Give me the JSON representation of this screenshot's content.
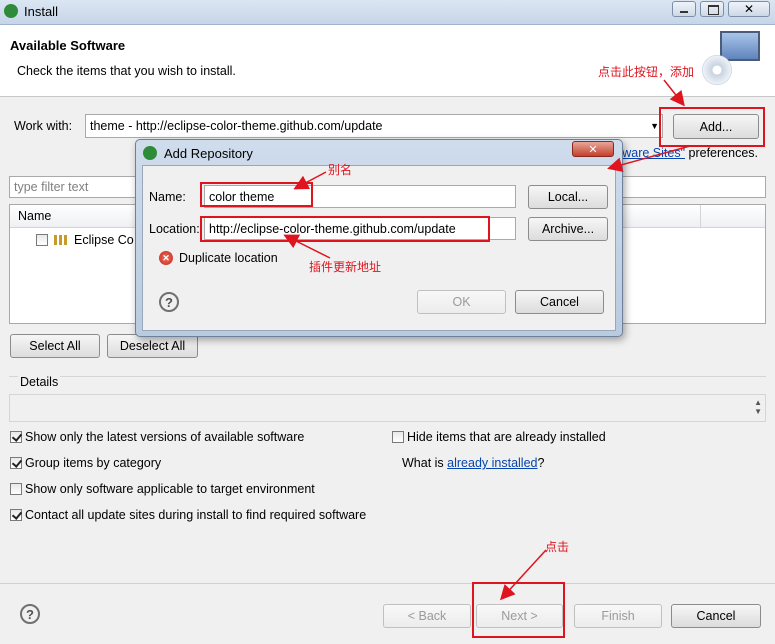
{
  "window": {
    "title": "Install",
    "section_title": "Available Software",
    "section_subtitle": "Check the items that you wish to install."
  },
  "work_with": {
    "label": "Work with:",
    "value": "theme - http://eclipse-color-theme.github.com/update",
    "add_label": "Add...",
    "hint_link": "Software Sites\"",
    "hint_suffix": "preferences."
  },
  "filter": {
    "placeholder": "type filter text"
  },
  "tree": {
    "column_name": "Name",
    "items": [
      {
        "label": "Eclipse Co"
      }
    ]
  },
  "buttons": {
    "select_all": "Select All",
    "deselect_all": "Deselect All",
    "back": "< Back",
    "next": "Next >",
    "finish": "Finish",
    "cancel": "Cancel"
  },
  "details": {
    "label": "Details"
  },
  "options": {
    "latest_versions": {
      "label": "Show only the latest versions of available software",
      "checked": true
    },
    "group_by_category": {
      "label": "Group items by category",
      "checked": true
    },
    "target_env": {
      "label": "Show only software applicable to target environment",
      "checked": false
    },
    "contact_sites": {
      "label": "Contact all update sites during install to find required software",
      "checked": true
    },
    "hide_installed": {
      "label": "Hide items that are already installed",
      "checked": false
    },
    "what_is_prefix": "What is ",
    "already_installed_link": "already installed",
    "what_is_suffix": "?"
  },
  "dialog": {
    "title": "Add Repository",
    "name_label": "Name:",
    "name_value": "color theme",
    "location_label": "Location:",
    "location_value": "http://eclipse-color-theme.github.com/update",
    "local_label": "Local...",
    "archive_label": "Archive...",
    "error_text": "Duplicate location",
    "ok_label": "OK",
    "cancel_label": "Cancel"
  },
  "annotations": {
    "add_hint": "点击此按钮，添加",
    "alias_hint": "别名",
    "url_hint": "插件更新地址",
    "click_hint": "点击"
  },
  "colors": {
    "annotation_red": "#e0141e",
    "link_blue": "#0645ad"
  }
}
